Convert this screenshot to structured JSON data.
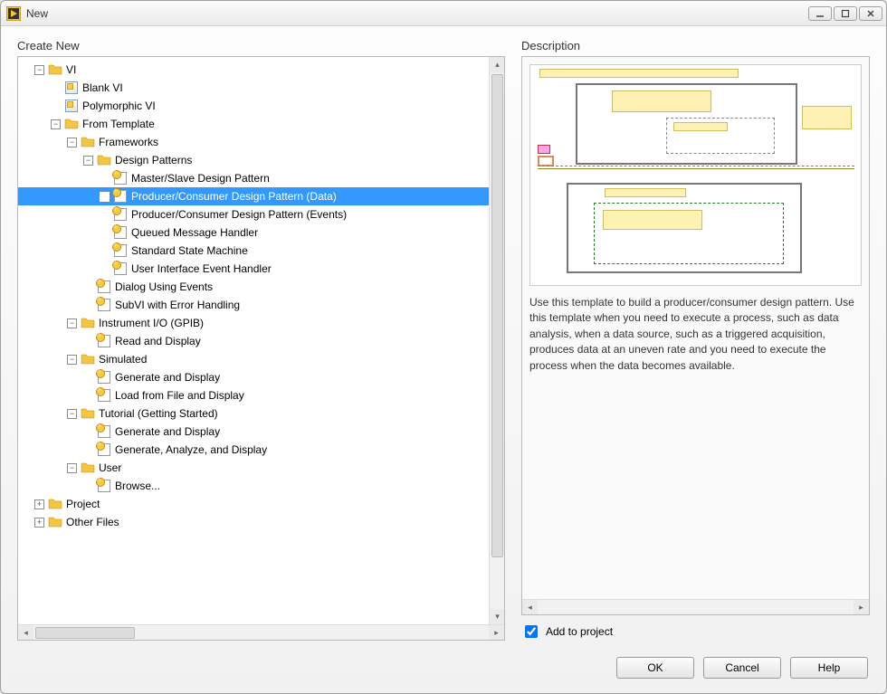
{
  "window": {
    "title": "New"
  },
  "panels": {
    "create_new": "Create New",
    "description": "Description"
  },
  "tree": {
    "root": "VI",
    "blank_vi": "Blank VI",
    "polymorphic_vi": "Polymorphic VI",
    "from_template": "From Template",
    "frameworks": "Frameworks",
    "design_patterns": "Design Patterns",
    "dp_master_slave": "Master/Slave Design Pattern",
    "dp_producer_data": "Producer/Consumer Design Pattern (Data)",
    "dp_producer_events": "Producer/Consumer Design Pattern (Events)",
    "dp_queued_msg": "Queued Message Handler",
    "dp_state_machine": "Standard State Machine",
    "dp_ui_event": "User Interface Event Handler",
    "dialog_events": "Dialog Using Events",
    "subvi_error": "SubVI with Error Handling",
    "instrument_io": "Instrument I/O (GPIB)",
    "read_display": "Read and Display",
    "simulated": "Simulated",
    "gen_display": "Generate and Display",
    "load_file_display": "Load from File and Display",
    "tutorial": "Tutorial (Getting Started)",
    "tut_gen_display": "Generate and Display",
    "tut_gen_analyze": "Generate, Analyze, and Display",
    "user": "User",
    "browse": "Browse...",
    "project": "Project",
    "other_files": "Other Files"
  },
  "description": {
    "text": "Use this template to build a producer/consumer design pattern. Use this template when you need to execute a process, such as data analysis, when a data source, such as a triggered acquisition, produces data at an uneven rate and you need to execute the process when the data becomes available."
  },
  "checkbox": {
    "add_to_project": "Add to project",
    "checked": true
  },
  "buttons": {
    "ok": "OK",
    "cancel": "Cancel",
    "help": "Help"
  }
}
